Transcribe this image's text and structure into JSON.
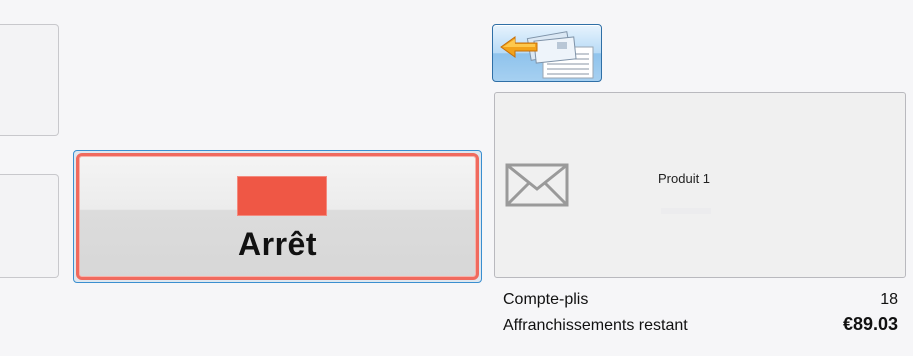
{
  "stop_button": {
    "label": "Arrêt",
    "indicator_color": "#ef5745"
  },
  "feed_button": {
    "icon": "arrow-left-documents-icon"
  },
  "product_panel": {
    "icon": "envelope-icon",
    "label": "Produit 1"
  },
  "stats": {
    "piece_count_label": "Compte-plis",
    "piece_count_value": "18",
    "postage_remaining_label": "Affranchissements restant",
    "postage_remaining_value": "€89.03"
  },
  "colors": {
    "accent_blue": "#3a8fd0",
    "stop_red": "#ef5745",
    "stop_border": "#f06a5e"
  }
}
